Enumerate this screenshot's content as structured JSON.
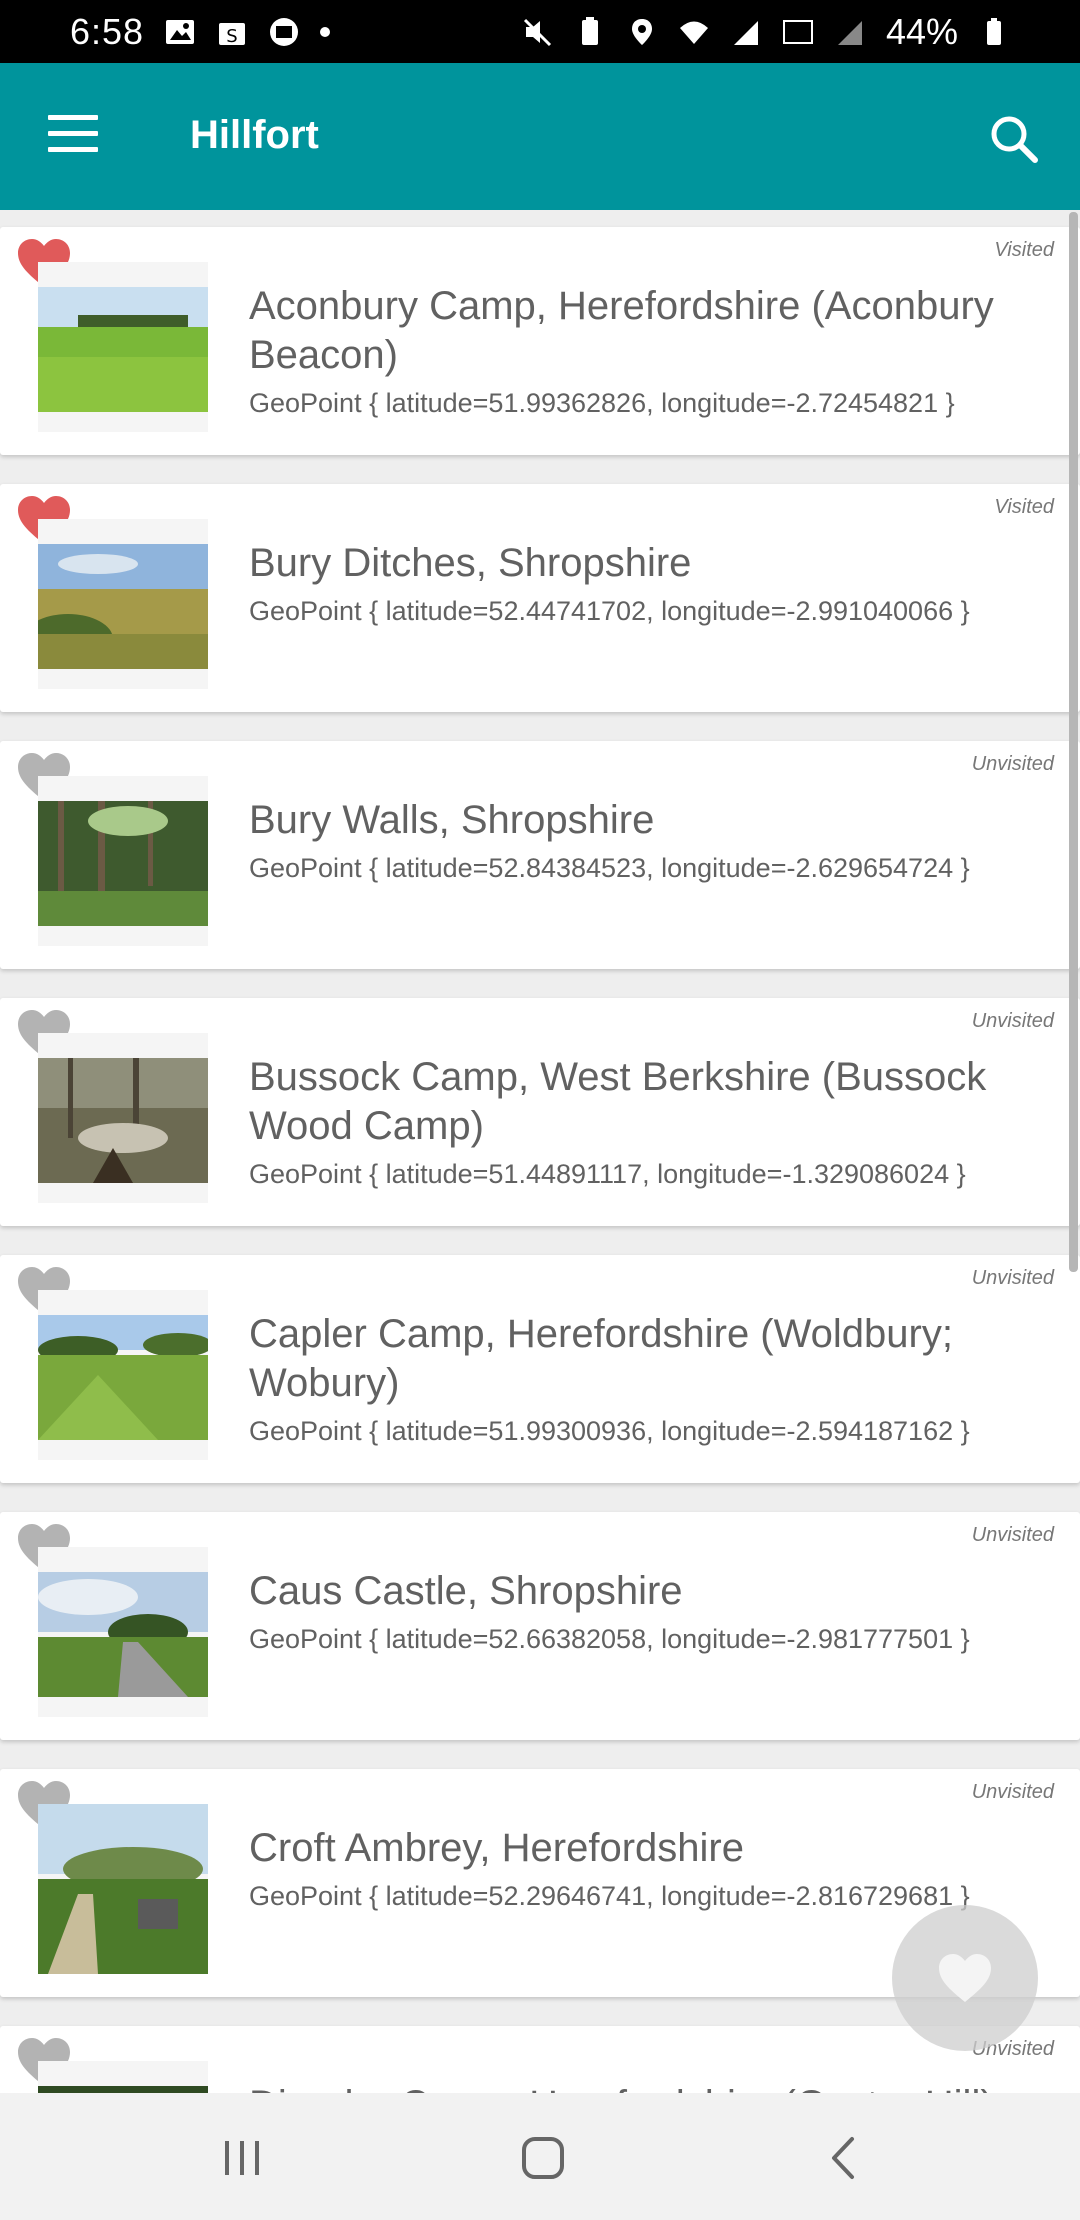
{
  "status_bar": {
    "time": "6:58",
    "battery": "44%",
    "left_icons": [
      "image-icon",
      "shopping-bag-icon",
      "zhi-icon",
      "dot-icon"
    ],
    "right_icons": [
      "mute-icon",
      "battery-saver-icon",
      "location-icon",
      "wifi-icon",
      "signal-icon",
      "volte-icon",
      "signal-icon-2",
      "battery-icon"
    ]
  },
  "app_bar": {
    "title": "Hillfort",
    "menu_icon": "hamburger-menu-icon",
    "search_icon": "search-icon"
  },
  "colors": {
    "primary": "#00949c",
    "visited_heart": "#e05a5a",
    "unvisited_heart": "#b3b3b3",
    "text": "#616161"
  },
  "hillforts": [
    {
      "name": "Aconbury Camp, Herefordshire (Aconbury Beacon)",
      "location": "GeoPoint { latitude=51.99362826, longitude=-2.72454821 }",
      "status": "Visited",
      "favourite": true,
      "image": "green-field-photo"
    },
    {
      "name": "Bury Ditches, Shropshire",
      "location": "GeoPoint { latitude=52.44741702, longitude=-2.991040066 }",
      "status": "Visited",
      "favourite": true,
      "image": "grassy-hill-photo"
    },
    {
      "name": "Bury Walls, Shropshire",
      "location": "GeoPoint { latitude=52.84384523, longitude=-2.629654724 }",
      "status": "Unvisited",
      "favourite": false,
      "image": "forest-photo"
    },
    {
      "name": "Bussock Camp, West Berkshire (Bussock Wood Camp)",
      "location": "GeoPoint { latitude=51.44891117, longitude=-1.329086024 }",
      "status": "Unvisited",
      "favourite": false,
      "image": "woodland-photo"
    },
    {
      "name": "Capler Camp, Herefordshire (Woldbury; Wobury)",
      "location": "GeoPoint { latitude=51.99300936, longitude=-2.594187162 }",
      "status": "Unvisited",
      "favourite": false,
      "image": "green-valley-photo"
    },
    {
      "name": "Caus Castle, Shropshire",
      "location": "GeoPoint { latitude=52.66382058, longitude=-2.981777501 }",
      "status": "Unvisited",
      "favourite": false,
      "image": "country-road-photo"
    },
    {
      "name": "Croft Ambrey, Herefordshire",
      "location": "GeoPoint { latitude=52.29646741, longitude=-2.816729681 }",
      "status": "Unvisited",
      "favourite": false,
      "image": "hill-path-photo"
    },
    {
      "name": "Dinedor Camp, Herefordshire (Oyster Hill)",
      "location": "",
      "status": "Unvisited",
      "favourite": false,
      "image": "partial-photo"
    }
  ],
  "fab": {
    "icon": "heart-icon"
  },
  "nav_bar": {
    "icons": [
      "recent-apps-icon",
      "home-icon",
      "back-icon"
    ]
  }
}
